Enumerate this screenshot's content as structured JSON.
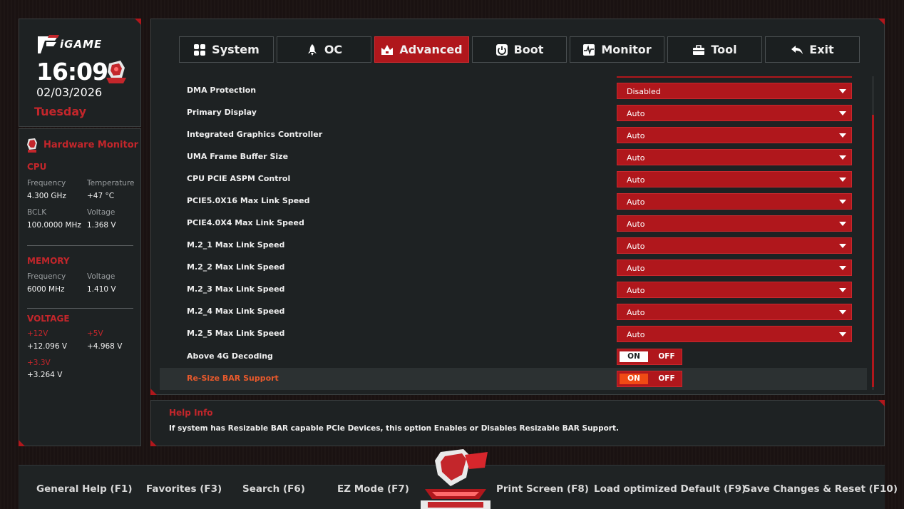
{
  "brand": {
    "logo_text": "iGAME"
  },
  "clock": {
    "time": "16:09",
    "date": "02/03/2026",
    "day": "Tuesday"
  },
  "hardware_monitor": {
    "title": "Hardware Monitor",
    "cpu": {
      "section": "CPU",
      "frequency_label": "Frequency",
      "frequency": "4.300 GHz",
      "temperature_label": "Temperature",
      "temperature": "+47 °C",
      "bclk_label": "BCLK",
      "bclk": "100.0000 MHz",
      "voltage_label": "Voltage",
      "voltage": "1.368 V"
    },
    "memory": {
      "section": "MEMORY",
      "frequency_label": "Frequency",
      "frequency": "6000 MHz",
      "voltage_label": "Voltage",
      "voltage": "1.410 V"
    },
    "voltage": {
      "section": "VOLTAGE",
      "v12_label": "+12V",
      "v12": "+12.096 V",
      "v5_label": "+5V",
      "v5": "+4.968 V",
      "v33_label": "+3.3V",
      "v33": "+3.264 V"
    }
  },
  "tabs": [
    {
      "label": "System",
      "icon": "grid-icon",
      "active": false
    },
    {
      "label": "OC",
      "icon": "rocket-icon",
      "active": false
    },
    {
      "label": "Advanced",
      "icon": "crown-icon",
      "active": true
    },
    {
      "label": "Boot",
      "icon": "power-icon",
      "active": false
    },
    {
      "label": "Monitor",
      "icon": "pulse-icon",
      "active": false
    },
    {
      "label": "Tool",
      "icon": "toolbox-icon",
      "active": false
    },
    {
      "label": "Exit",
      "icon": "back-arrow-icon",
      "active": false
    }
  ],
  "settings": [
    {
      "label": "DMA Protection",
      "type": "dropdown",
      "value": "Disabled"
    },
    {
      "label": "Primary Display",
      "type": "dropdown",
      "value": "Auto"
    },
    {
      "label": "Integrated Graphics Controller",
      "type": "dropdown",
      "value": "Auto"
    },
    {
      "label": "UMA Frame Buffer Size",
      "type": "dropdown",
      "value": "Auto"
    },
    {
      "label": "CPU PCIE ASPM Control",
      "type": "dropdown",
      "value": "Auto"
    },
    {
      "label": "PCIE5.0X16 Max Link Speed",
      "type": "dropdown",
      "value": "Auto"
    },
    {
      "label": "PCIE4.0X4 Max Link Speed",
      "type": "dropdown",
      "value": "Auto"
    },
    {
      "label": "M.2_1 Max Link Speed",
      "type": "dropdown",
      "value": "Auto"
    },
    {
      "label": "M.2_2 Max Link Speed",
      "type": "dropdown",
      "value": "Auto"
    },
    {
      "label": "M.2_3 Max Link Speed",
      "type": "dropdown",
      "value": "Auto"
    },
    {
      "label": "M.2_4 Max Link Speed",
      "type": "dropdown",
      "value": "Auto"
    },
    {
      "label": "M.2_5 Max Link Speed",
      "type": "dropdown",
      "value": "Auto"
    },
    {
      "label": "Above 4G Decoding",
      "type": "toggle",
      "on_label": "ON",
      "off_label": "OFF",
      "value": "ON"
    },
    {
      "label": "Re-Size BAR Support",
      "type": "toggle",
      "on_label": "ON",
      "off_label": "OFF",
      "value": "ON",
      "selected": true
    }
  ],
  "help": {
    "title": "Help Info",
    "text": "If system has Resizable BAR capable PCIe Devices, this option Enables or Disables Resizable BAR Support."
  },
  "footer": {
    "general_help": "General Help (F1)",
    "favorites": "Favorites (F3)",
    "search": "Search (F6)",
    "ez_mode": "EZ Mode (F7)",
    "print_screen": "Print Screen (F8)",
    "load_default": "Load optimized Default (F9)",
    "save_reset": "Save Changes & Reset (F10)"
  },
  "colors": {
    "accent": "#b0171c",
    "highlight": "#f04a14",
    "panel": "#1e2223"
  }
}
